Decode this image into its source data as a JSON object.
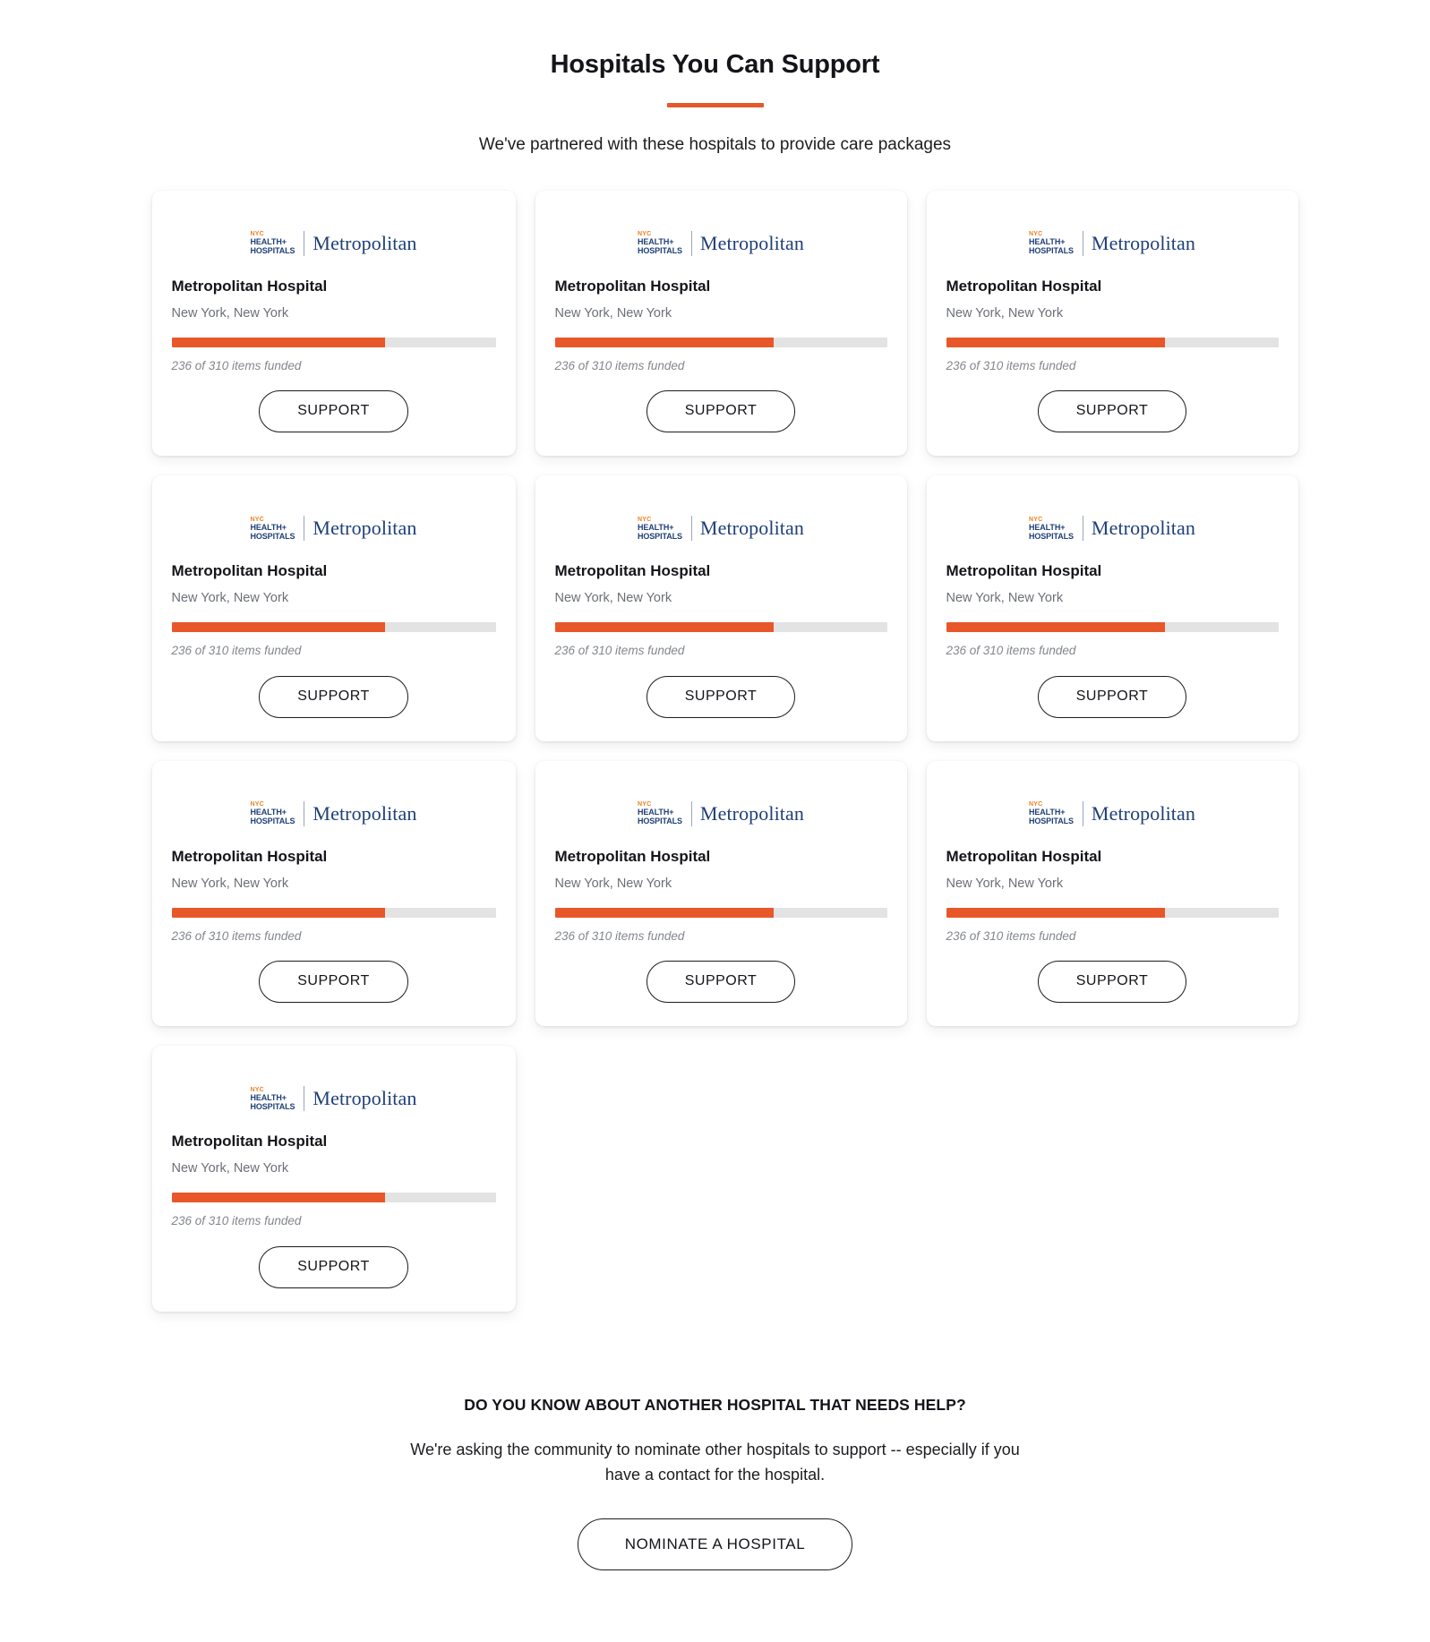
{
  "header": {
    "title": "Hospitals You Can Support",
    "subtitle": "We've partnered with these hospitals to provide care packages",
    "accent_color": "#e2592b"
  },
  "logo": {
    "nyc": "NYC",
    "health": "HEALTH+",
    "hospitals": "HOSPITALS",
    "wordmark": "Metropolitan",
    "nyc_color": "#f08122",
    "text_color": "#1f3f77"
  },
  "cards": [
    {
      "name": "Metropolitan Hospital",
      "location": "New York, New York",
      "funded_text": "236 of 310 items funded",
      "funded": 236,
      "total": 310,
      "percent": 66,
      "button": "SUPPORT"
    },
    {
      "name": "Metropolitan Hospital",
      "location": "New York, New York",
      "funded_text": "236 of 310 items funded",
      "funded": 236,
      "total": 310,
      "percent": 66,
      "button": "SUPPORT"
    },
    {
      "name": "Metropolitan Hospital",
      "location": "New York, New York",
      "funded_text": "236 of 310 items funded",
      "funded": 236,
      "total": 310,
      "percent": 66,
      "button": "SUPPORT"
    },
    {
      "name": "Metropolitan Hospital",
      "location": "New York, New York",
      "funded_text": "236 of 310 items funded",
      "funded": 236,
      "total": 310,
      "percent": 66,
      "button": "SUPPORT"
    },
    {
      "name": "Metropolitan Hospital",
      "location": "New York, New York",
      "funded_text": "236 of 310 items funded",
      "funded": 236,
      "total": 310,
      "percent": 66,
      "button": "SUPPORT"
    },
    {
      "name": "Metropolitan Hospital",
      "location": "New York, New York",
      "funded_text": "236 of 310 items funded",
      "funded": 236,
      "total": 310,
      "percent": 66,
      "button": "SUPPORT"
    },
    {
      "name": "Metropolitan Hospital",
      "location": "New York, New York",
      "funded_text": "236 of 310 items funded",
      "funded": 236,
      "total": 310,
      "percent": 66,
      "button": "SUPPORT"
    },
    {
      "name": "Metropolitan Hospital",
      "location": "New York, New York",
      "funded_text": "236 of 310 items funded",
      "funded": 236,
      "total": 310,
      "percent": 66,
      "button": "SUPPORT"
    },
    {
      "name": "Metropolitan Hospital",
      "location": "New York, New York",
      "funded_text": "236 of 310 items funded",
      "funded": 236,
      "total": 310,
      "percent": 66,
      "button": "SUPPORT"
    },
    {
      "name": "Metropolitan Hospital",
      "location": "New York, New York",
      "funded_text": "236 of 310 items funded",
      "funded": 236,
      "total": 310,
      "percent": 66,
      "button": "SUPPORT"
    }
  ],
  "cta": {
    "heading": "DO YOU KNOW ABOUT ANOTHER HOSPITAL THAT NEEDS HELP?",
    "text": "We're asking the community to nominate other hospitals to support -- especially if you have a contact for the hospital.",
    "button": "NOMINATE A HOSPITAL"
  },
  "colors": {
    "progress_fill": "#e8572a",
    "progress_track": "#e3e3e3"
  }
}
